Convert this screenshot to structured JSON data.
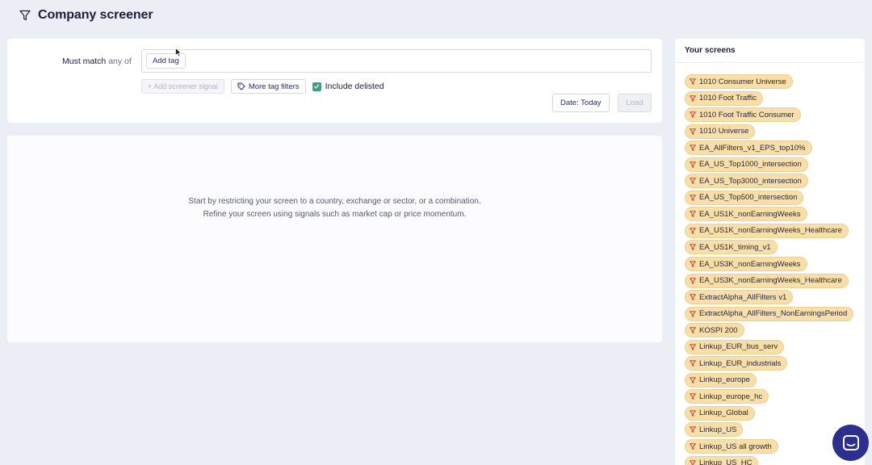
{
  "header": {
    "title": "Company screener",
    "icon": "filter-icon"
  },
  "filters": {
    "must_match_label": "Must match",
    "any_of_label": "any of",
    "add_tag_label": "Add tag",
    "add_signal_label": "+ Add screener signal",
    "more_tag_filters_label": "More tag filters",
    "include_delisted_label": "Include delisted",
    "include_delisted_checked": true,
    "date_button_label": "Date: Today",
    "load_button_label": "Load"
  },
  "results": {
    "empty_line1": "Start by restricting your screen to a country, exchange or sector, or a combination.",
    "empty_line2": "Refine your screen using signals such as market cap or price momentum."
  },
  "screens": {
    "title": "Your screens",
    "items": [
      "1010 Consumer Universe",
      "1010 Foot Traffic",
      "1010 Foot Traffic Consumer",
      "1010 Universe",
      "EA_AllFilters_v1_EPS_top10%",
      "EA_US_Top1000_intersection",
      "EA_US_Top3000_intersection",
      "EA_US_Top500_intersection",
      "EA_US1K_nonEarningWeeks",
      "EA_US1K_nonEarningWeeks_Healthcare",
      "EA_US1K_timing_v1",
      "EA_US3K_nonEarningWeeks",
      "EA_US3K_nonEarningWeeks_Healthcare",
      "ExtractAlpha_AllFilters v1",
      "ExtractAlpha_AllFilters_NonEarningsPeriod",
      "KOSPI 200",
      "Linkup_EUR_bus_serv",
      "Linkup_EUR_industrials",
      "Linkup_europe",
      "Linkup_europe_hc",
      "Linkup_Global",
      "Linkup_US",
      "Linkup_US all growth",
      "Linkup_US_HC"
    ]
  },
  "colors": {
    "background": "#eceef5",
    "accent": "#242a8f",
    "chip_fill": "#f8dea8",
    "checkbox": "#3f9f86",
    "chat_button": "#2b2f8f"
  }
}
